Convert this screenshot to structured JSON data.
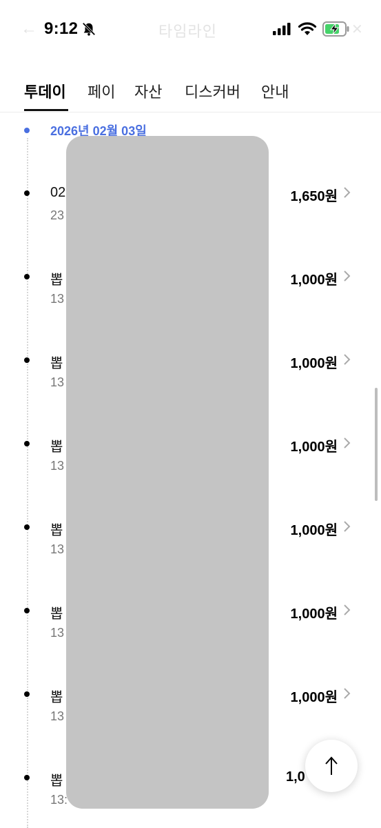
{
  "status_bar": {
    "time": "9:12",
    "back_glyph": "←",
    "header_title": "타임라인",
    "icons": [
      "bell-slash-icon",
      "signal-icon",
      "wifi-icon",
      "battery-charging-icon"
    ]
  },
  "tabs": [
    {
      "label": "투데이",
      "active": true
    },
    {
      "label": "페이",
      "active": false
    },
    {
      "label": "자산",
      "active": false
    },
    {
      "label": "디스커버",
      "active": false
    },
    {
      "label": "안내",
      "active": false
    }
  ],
  "timeline": {
    "date": "2026년 02월 03일",
    "accent_color": "#4a6fe0",
    "items": [
      {
        "title": "02",
        "sub": "23",
        "amount": "1,650원"
      },
      {
        "title": "뽑",
        "sub": "13",
        "amount": "1,000원"
      },
      {
        "title": "뽑",
        "sub": "13",
        "amount": "1,000원"
      },
      {
        "title": "뽑",
        "sub": "13",
        "amount": "1,000원"
      },
      {
        "title": "뽑",
        "sub": "13",
        "amount": "1,000원"
      },
      {
        "title": "뽑",
        "sub": "13",
        "amount": "1,000원"
      },
      {
        "title": "뽑",
        "sub": "13",
        "amount": "1,000원"
      },
      {
        "title": "뽑",
        "sub": "13:",
        "amount": "1,0"
      }
    ]
  },
  "scroll_top": {
    "icon": "arrow-up-icon",
    "glyph": "↑"
  }
}
